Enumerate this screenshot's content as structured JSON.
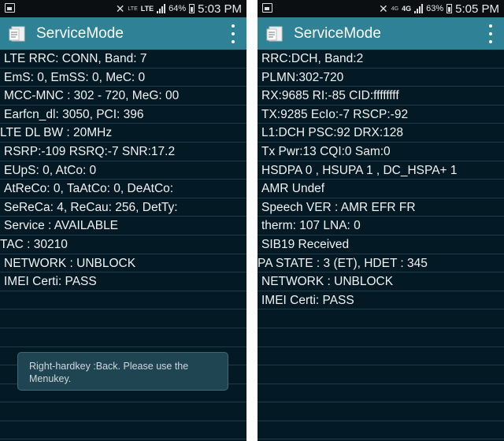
{
  "left": {
    "statusbar": {
      "network_small": "LTE",
      "network_large": "LTE",
      "battery": "64%",
      "time": "5:03 PM"
    },
    "appbar": {
      "title": "ServiceMode"
    },
    "rows": [
      {
        "text": "LTE RRC: CONN, Band: 7",
        "indent": true
      },
      {
        "text": "EmS: 0, EmSS: 0, MeC: 0",
        "indent": true
      },
      {
        "text": "MCC-MNC : 302 - 720, MeG: 00",
        "indent": true
      },
      {
        "text": "Earfcn_dl: 3050, PCI: 396",
        "indent": true
      },
      {
        "text": "LTE DL BW : 20MHz",
        "indent": false
      },
      {
        "text": "RSRP:-109 RSRQ:-7 SNR:17.2",
        "indent": true
      },
      {
        "text": "EUpS: 0, AtCo: 0",
        "indent": true
      },
      {
        "text": "AtReCo: 0, TaAtCo: 0, DeAtCo:",
        "indent": true
      },
      {
        "text": "SeReCa: 4, ReCau: 256, DetTy:",
        "indent": true
      },
      {
        "text": "Service : AVAILABLE",
        "indent": true
      },
      {
        "text": "TAC : 30210",
        "indent": false
      },
      {
        "text": "NETWORK : UNBLOCK",
        "indent": true
      },
      {
        "text": "IMEI Certi: PASS",
        "indent": true
      },
      {
        "text": "",
        "indent": true
      },
      {
        "text": "",
        "indent": true
      },
      {
        "text": "",
        "indent": true
      },
      {
        "text": "",
        "indent": true
      },
      {
        "text": "",
        "indent": true
      },
      {
        "text": "",
        "indent": true
      },
      {
        "text": "",
        "indent": true
      },
      {
        "text": "",
        "indent": true
      }
    ],
    "toast": "Right-hardkey :Back.   Please use the Menukey."
  },
  "right": {
    "statusbar": {
      "network_small": "4G",
      "network_large": "4G",
      "battery": "63%",
      "time": "5:05 PM"
    },
    "appbar": {
      "title": "ServiceMode"
    },
    "rows": [
      {
        "text": "RRC:DCH, Band:2",
        "indent": true
      },
      {
        "text": "PLMN:302-720",
        "indent": true
      },
      {
        "text": "RX:9685 RI:-85 CID:ffffffff",
        "indent": true
      },
      {
        "text": "TX:9285 EcIo:-7 RSCP:-92",
        "indent": true
      },
      {
        "text": "L1:DCH PSC:92 DRX:128",
        "indent": true
      },
      {
        "text": "Tx Pwr:13 CQI:0 Sam:0",
        "indent": true
      },
      {
        "text": "HSDPA 0 , HSUPA 1 , DC_HSPA+ 1",
        "indent": true
      },
      {
        "text": "AMR Undef",
        "indent": true
      },
      {
        "text": "Speech VER : AMR EFR FR",
        "indent": true
      },
      {
        "text": "therm: 107 LNA: 0",
        "indent": true
      },
      {
        "text": "SIB19 Received",
        "indent": true
      },
      {
        "text": "PA STATE : 3 (ET), HDET : 345",
        "indent": false
      },
      {
        "text": "NETWORK : UNBLOCK",
        "indent": true
      },
      {
        "text": "IMEI Certi: PASS",
        "indent": true
      },
      {
        "text": "",
        "indent": true
      },
      {
        "text": "",
        "indent": true
      },
      {
        "text": "",
        "indent": true
      },
      {
        "text": "",
        "indent": true
      },
      {
        "text": "",
        "indent": true
      },
      {
        "text": "",
        "indent": true
      },
      {
        "text": "",
        "indent": true
      }
    ]
  },
  "colors": {
    "appbar": "#2f8295",
    "background": "#031a24",
    "row_divider": "#1f3d48",
    "statusbar": "#0b0f12"
  },
  "icons": [
    "gallery-notification-icon",
    "mute-icon",
    "signal-icon",
    "battery-icon",
    "service-mode-app-icon",
    "overflow-menu-icon"
  ]
}
